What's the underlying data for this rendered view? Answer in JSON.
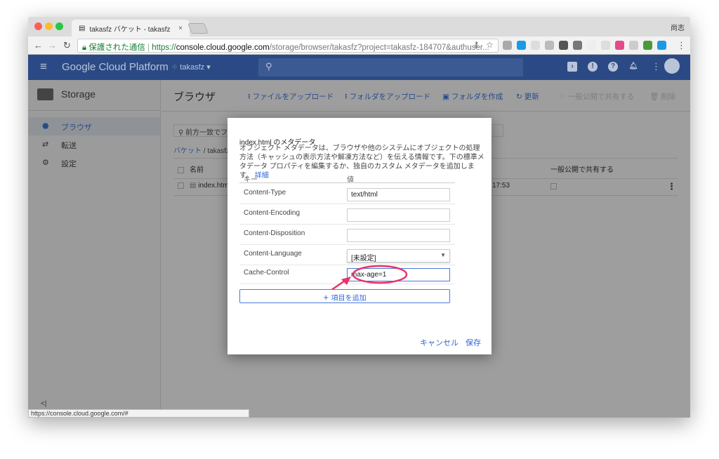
{
  "browser": {
    "tab_title": "takasfz バケット - takasfz",
    "user": "尚志",
    "secure_label": "保護された通信",
    "url_scheme": "https://",
    "url_host": "console.cloud.google.com",
    "url_path": "/storage/browser/takasfz?project=takasfz-184707&authuser...",
    "status_url": "https://console.cloud.google.com/#"
  },
  "header": {
    "brand": "Google Cloud Platform",
    "project": "takasfz"
  },
  "sidebar": {
    "title": "Storage",
    "items": [
      {
        "label": "ブラウザ",
        "icon": "bucket-icon"
      },
      {
        "label": "転送",
        "icon": "transfer-icon"
      },
      {
        "label": "設定",
        "icon": "gear-icon"
      }
    ]
  },
  "main": {
    "title": "ブラウザ",
    "toolbar": [
      {
        "label": "ファイルをアップロード",
        "icon": "upload-icon"
      },
      {
        "label": "フォルダをアップロード",
        "icon": "upload-icon"
      },
      {
        "label": "フォルダを作成",
        "icon": "folder-plus-icon"
      },
      {
        "label": "更新",
        "icon": "refresh-icon"
      },
      {
        "label": "一般公開で共有する",
        "icon": "people-icon"
      },
      {
        "label": "削除",
        "icon": "trash-icon"
      }
    ],
    "filter_placeholder": "前方一致でフィ",
    "breadcrumb": {
      "root": "バケット",
      "current": "takasfz"
    },
    "columns": {
      "name": "名前",
      "public": "一般公開で共有する"
    },
    "rows": [
      {
        "name": "index.htm",
        "time": "17:53"
      }
    ]
  },
  "dialog": {
    "title": "index.html のメタデータ",
    "description": "オブジェクト メタデータは、ブラウザや他のシステムにオブジェクトの処理方法（キャッシュの表示方法や解凍方法など）を伝える情報です。下の標準メタデータ プロパティを編集するか、独自のカスタム メタデータを追加します。",
    "details_link": "詳細",
    "col_key": "キー",
    "col_value": "値",
    "fields": [
      {
        "key": "Content-Type",
        "value": "text/html"
      },
      {
        "key": "Content-Encoding",
        "value": ""
      },
      {
        "key": "Content-Disposition",
        "value": ""
      },
      {
        "key": "Content-Language",
        "value": "[未設定]"
      },
      {
        "key": "Cache-Control",
        "value": "max-age=1"
      }
    ],
    "add_item": "項目を追加",
    "cancel": "キャンセル",
    "save": "保存"
  }
}
